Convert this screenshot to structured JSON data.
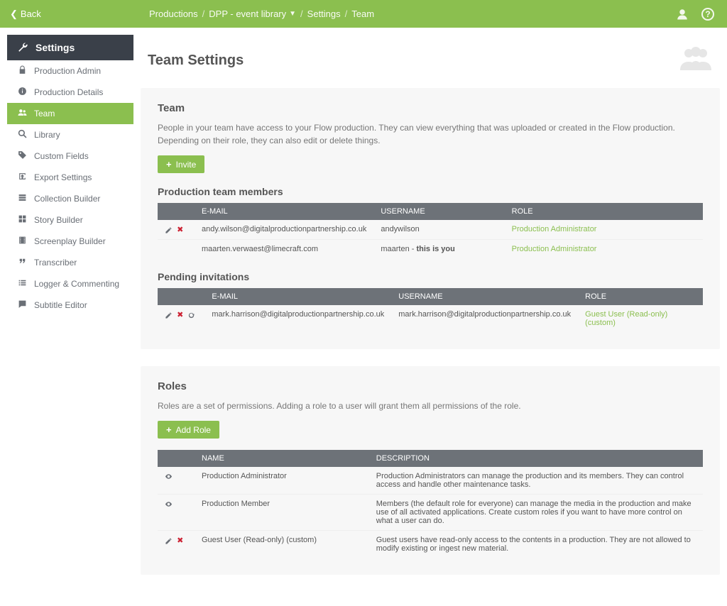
{
  "topbar": {
    "back": "Back",
    "crumbs": [
      "Productions",
      "DPP - event library",
      "Settings",
      "Team"
    ]
  },
  "sidebar": {
    "header": "Settings",
    "items": [
      {
        "label": "Production Admin",
        "icon": "lock"
      },
      {
        "label": "Production Details",
        "icon": "info"
      },
      {
        "label": "Team",
        "icon": "users",
        "active": true
      },
      {
        "label": "Library",
        "icon": "search"
      },
      {
        "label": "Custom Fields",
        "icon": "tag"
      },
      {
        "label": "Export Settings",
        "icon": "export"
      },
      {
        "label": "Collection Builder",
        "icon": "stack"
      },
      {
        "label": "Story Builder",
        "icon": "grid"
      },
      {
        "label": "Screenplay Builder",
        "icon": "film"
      },
      {
        "label": "Transcriber",
        "icon": "quote"
      },
      {
        "label": "Logger & Commenting",
        "icon": "list"
      },
      {
        "label": "Subtitle Editor",
        "icon": "chat"
      }
    ]
  },
  "page": {
    "title": "Team Settings"
  },
  "team": {
    "heading": "Team",
    "description": "People in your team have access to your Flow production. They can view everything that was uploaded or created in the Flow production. Depending on their role, they can also edit or delete things.",
    "invite_btn": "Invite",
    "members_heading": "Production team members",
    "headers": {
      "email": "E-MAIL",
      "username": "USERNAME",
      "role": "ROLE"
    },
    "members": [
      {
        "email": "andy.wilson@digitalproductionpartnership.co.uk",
        "username": "andywilson",
        "role": "Production Administrator",
        "editable": true
      },
      {
        "email": "maarten.verwaest@limecraft.com",
        "username_prefix": "maarten - ",
        "username_you": "this is you",
        "role": "Production Administrator",
        "editable": false
      }
    ],
    "pending_heading": "Pending invitations",
    "pending": [
      {
        "email": "mark.harrison@digitalproductionpartnership.co.uk",
        "username": "mark.harrison@digitalproductionpartnership.co.uk",
        "role": "Guest User (Read-only) (custom)"
      }
    ]
  },
  "roles": {
    "heading": "Roles",
    "description": "Roles are a set of permissions. Adding a role to a user will grant them all permissions of the role.",
    "add_btn": "Add Role",
    "headers": {
      "name": "NAME",
      "description": "DESCRIPTION"
    },
    "items": [
      {
        "name": "Production Administrator",
        "desc": "Production Administrators can manage the production and its members. They can control access and handle other maintenance tasks.",
        "eye": true,
        "editable": false
      },
      {
        "name": "Production Member",
        "desc": "Members (the default role for everyone) can manage the media in the production and make use of all activated applications. Create custom roles if you want to have more control on what a user can do.",
        "eye": true,
        "editable": false
      },
      {
        "name": "Guest User (Read-only) (custom)",
        "desc": "Guest users have read-only access to the contents in a production. They are not allowed to modify existing or ingest new material.",
        "eye": false,
        "editable": true
      }
    ]
  }
}
